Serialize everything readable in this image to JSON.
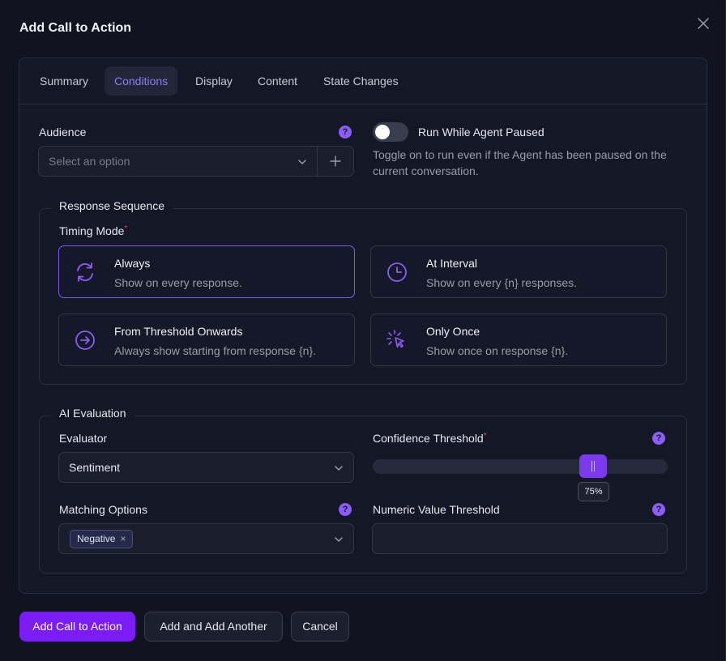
{
  "dialog": {
    "title": "Add Call to Action"
  },
  "tabs": [
    {
      "label": "Summary"
    },
    {
      "label": "Conditions"
    },
    {
      "label": "Display"
    },
    {
      "label": "Content"
    },
    {
      "label": "State Changes"
    }
  ],
  "audience": {
    "label": "Audience",
    "placeholder": "Select an option",
    "help": "?"
  },
  "run_while_paused": {
    "label": "Run While Agent Paused",
    "enabled": false,
    "description_line1": "Toggle on to run even if the Agent has been paused on the",
    "description_line2": "current conversation."
  },
  "response_sequence": {
    "legend": "Response Sequence",
    "timing_label": "Timing Mode",
    "required_mark": "*",
    "options": [
      {
        "title": "Always",
        "desc": "Show on every response.",
        "icon": "refresh-icon",
        "selected": true
      },
      {
        "title": "At Interval",
        "desc": "Show on every {n} responses.",
        "icon": "clock-icon",
        "selected": false
      },
      {
        "title": "From Threshold Onwards",
        "desc": "Always show starting from response {n}.",
        "icon": "arrow-circle-right-icon",
        "selected": false
      },
      {
        "title": "Only Once",
        "desc": "Show once on response {n}.",
        "icon": "cursor-click-icon",
        "selected": false
      }
    ]
  },
  "ai_evaluation": {
    "legend": "AI Evaluation",
    "evaluator_label": "Evaluator",
    "evaluator_value": "Sentiment",
    "confidence_label": "Confidence Threshold",
    "required_mark": "*",
    "confidence_value": 0.75,
    "confidence_display": "75%",
    "matching_label": "Matching Options",
    "matching_tags": [
      {
        "label": "Negative",
        "remove": "×"
      }
    ],
    "numeric_label": "Numeric Value Threshold",
    "numeric_value": "",
    "help": "?"
  },
  "footer": {
    "add_label": "Add Call to Action",
    "add_another_label": "Add and Add Another",
    "cancel_label": "Cancel"
  },
  "colors": {
    "accent": "#7c1cf5",
    "accent_light": "#8b7cf6",
    "background": "#111320"
  }
}
